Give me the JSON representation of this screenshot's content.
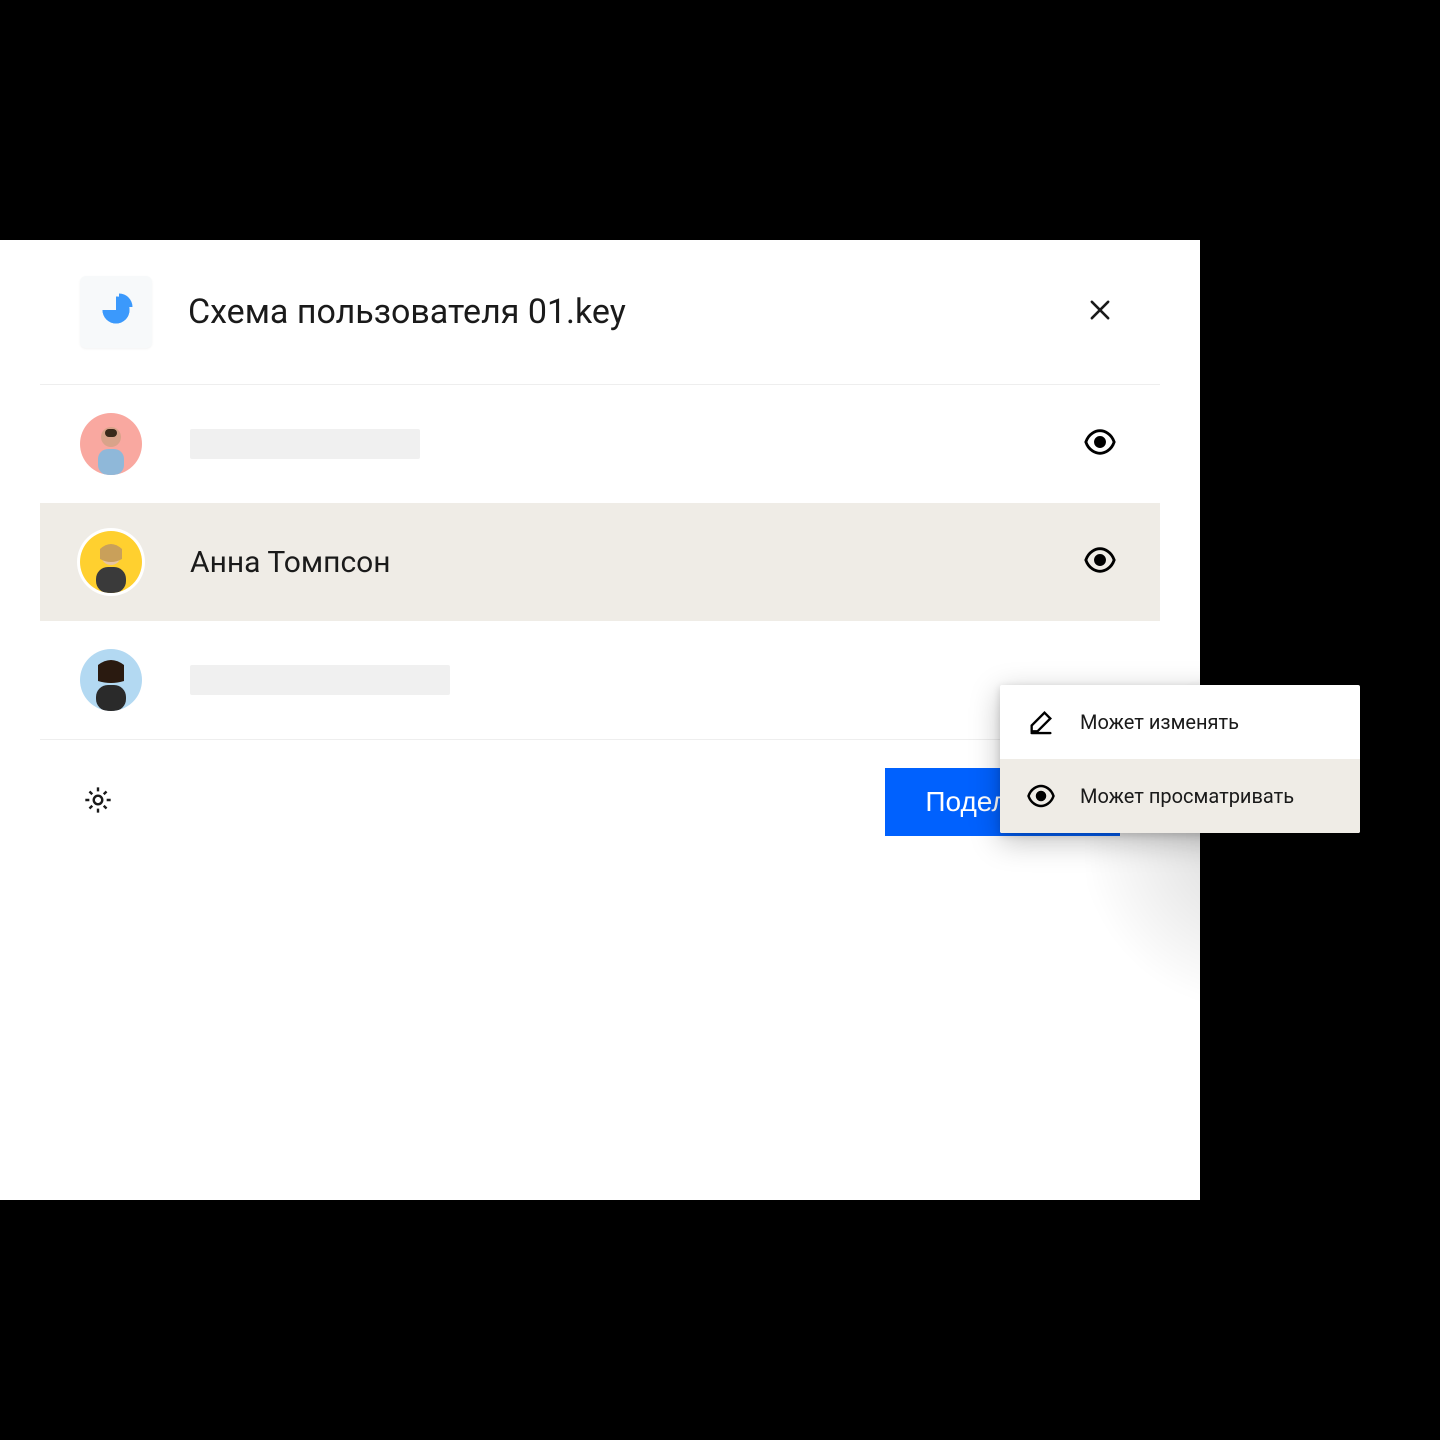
{
  "header": {
    "filename": "Схема пользователя 01.key",
    "file_icon": "pie-chart-icon",
    "close_label": "close"
  },
  "people": [
    {
      "name": "",
      "avatar_color": "pink",
      "permission_icon": "eye",
      "selected": false,
      "placeholder": true
    },
    {
      "name": "Анна Томпсон",
      "avatar_color": "yellow",
      "permission_icon": "eye",
      "selected": true,
      "placeholder": false
    },
    {
      "name": "",
      "avatar_color": "blue",
      "permission_icon": "",
      "selected": false,
      "placeholder": true
    }
  ],
  "popover": {
    "items": [
      {
        "icon": "pencil",
        "label": "Может изменять",
        "active": false
      },
      {
        "icon": "eye",
        "label": "Может просматривать",
        "active": true
      }
    ]
  },
  "footer": {
    "settings_label": "settings",
    "share_label": "Поделиться"
  },
  "colors": {
    "primary": "#0061fe",
    "row_selected": "#efece6"
  }
}
